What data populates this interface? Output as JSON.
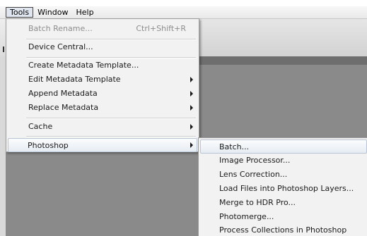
{
  "menubar": {
    "items": [
      {
        "label": "Tools"
      },
      {
        "label": "Window"
      },
      {
        "label": "Help"
      }
    ]
  },
  "tools_menu": {
    "items": [
      {
        "label": "Batch Rename...",
        "shortcut": "Ctrl+Shift+R"
      },
      {
        "label": "Device Central..."
      },
      {
        "label": "Create Metadata Template..."
      },
      {
        "label": "Edit Metadata Template"
      },
      {
        "label": "Append Metadata"
      },
      {
        "label": "Replace Metadata"
      },
      {
        "label": "Cache"
      },
      {
        "label": "Photoshop"
      }
    ]
  },
  "photoshop_submenu": {
    "items": [
      {
        "label": "Batch..."
      },
      {
        "label": "Image Processor..."
      },
      {
        "label": "Lens Correction..."
      },
      {
        "label": "Load Files into Photoshop Layers..."
      },
      {
        "label": "Merge to HDR Pro..."
      },
      {
        "label": "Photomerge..."
      },
      {
        "label": "Process Collections in Photoshop"
      }
    ]
  }
}
